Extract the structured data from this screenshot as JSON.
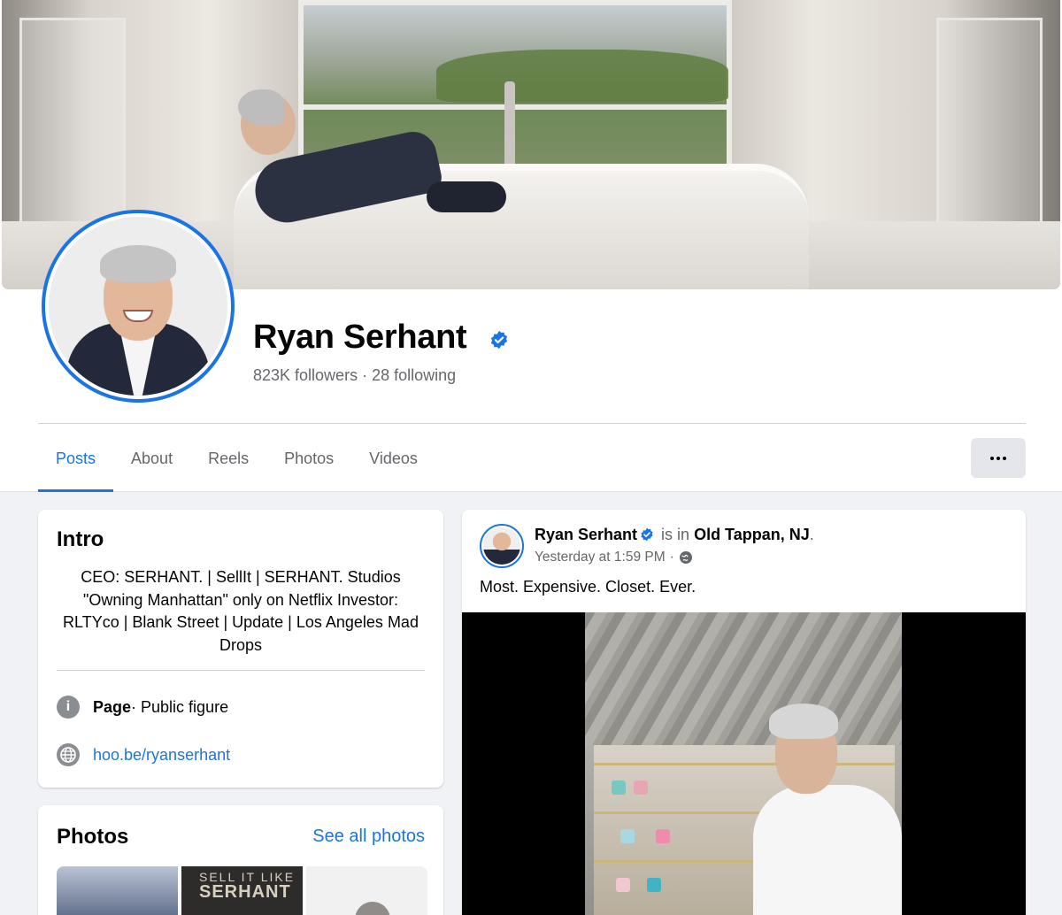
{
  "profile": {
    "name": "Ryan Serhant",
    "followers": "823K followers",
    "separator": "·",
    "following": "28 following"
  },
  "tabs": [
    {
      "label": "Posts",
      "active": true
    },
    {
      "label": "About"
    },
    {
      "label": "Reels"
    },
    {
      "label": "Photos"
    },
    {
      "label": "Videos"
    }
  ],
  "intro": {
    "title": "Intro",
    "bio": "CEO: SERHANT. | SellIt | SERHANT. Studios \"Owning Manhattan\" only on Netflix Investor: RLTYco | Blank Street | Update | Los Angeles Mad Drops",
    "page_label": "Page",
    "page_category": " · Public figure",
    "website": "hoo.be/ryanserhant",
    "info_icon": "i"
  },
  "photos": {
    "title": "Photos",
    "see_all": "See all photos",
    "thumb2_line1": "SELL IT LIKE",
    "thumb2_line2": "SERHANT"
  },
  "post": {
    "author": "Ryan Serhant",
    "is_in": " is in ",
    "location": "Old Tappan, NJ",
    "period": ".",
    "time": "Yesterday at 1:59 PM",
    "time_sep": "·",
    "text": "Most. Expensive. Closet. Ever."
  },
  "colors": {
    "accent": "#1b74e4",
    "background": "#f0f2f5",
    "muted_text": "#65676b"
  },
  "icons": [
    "verified-badge-icon",
    "info-icon",
    "globe-icon",
    "more-dots-icon"
  ]
}
